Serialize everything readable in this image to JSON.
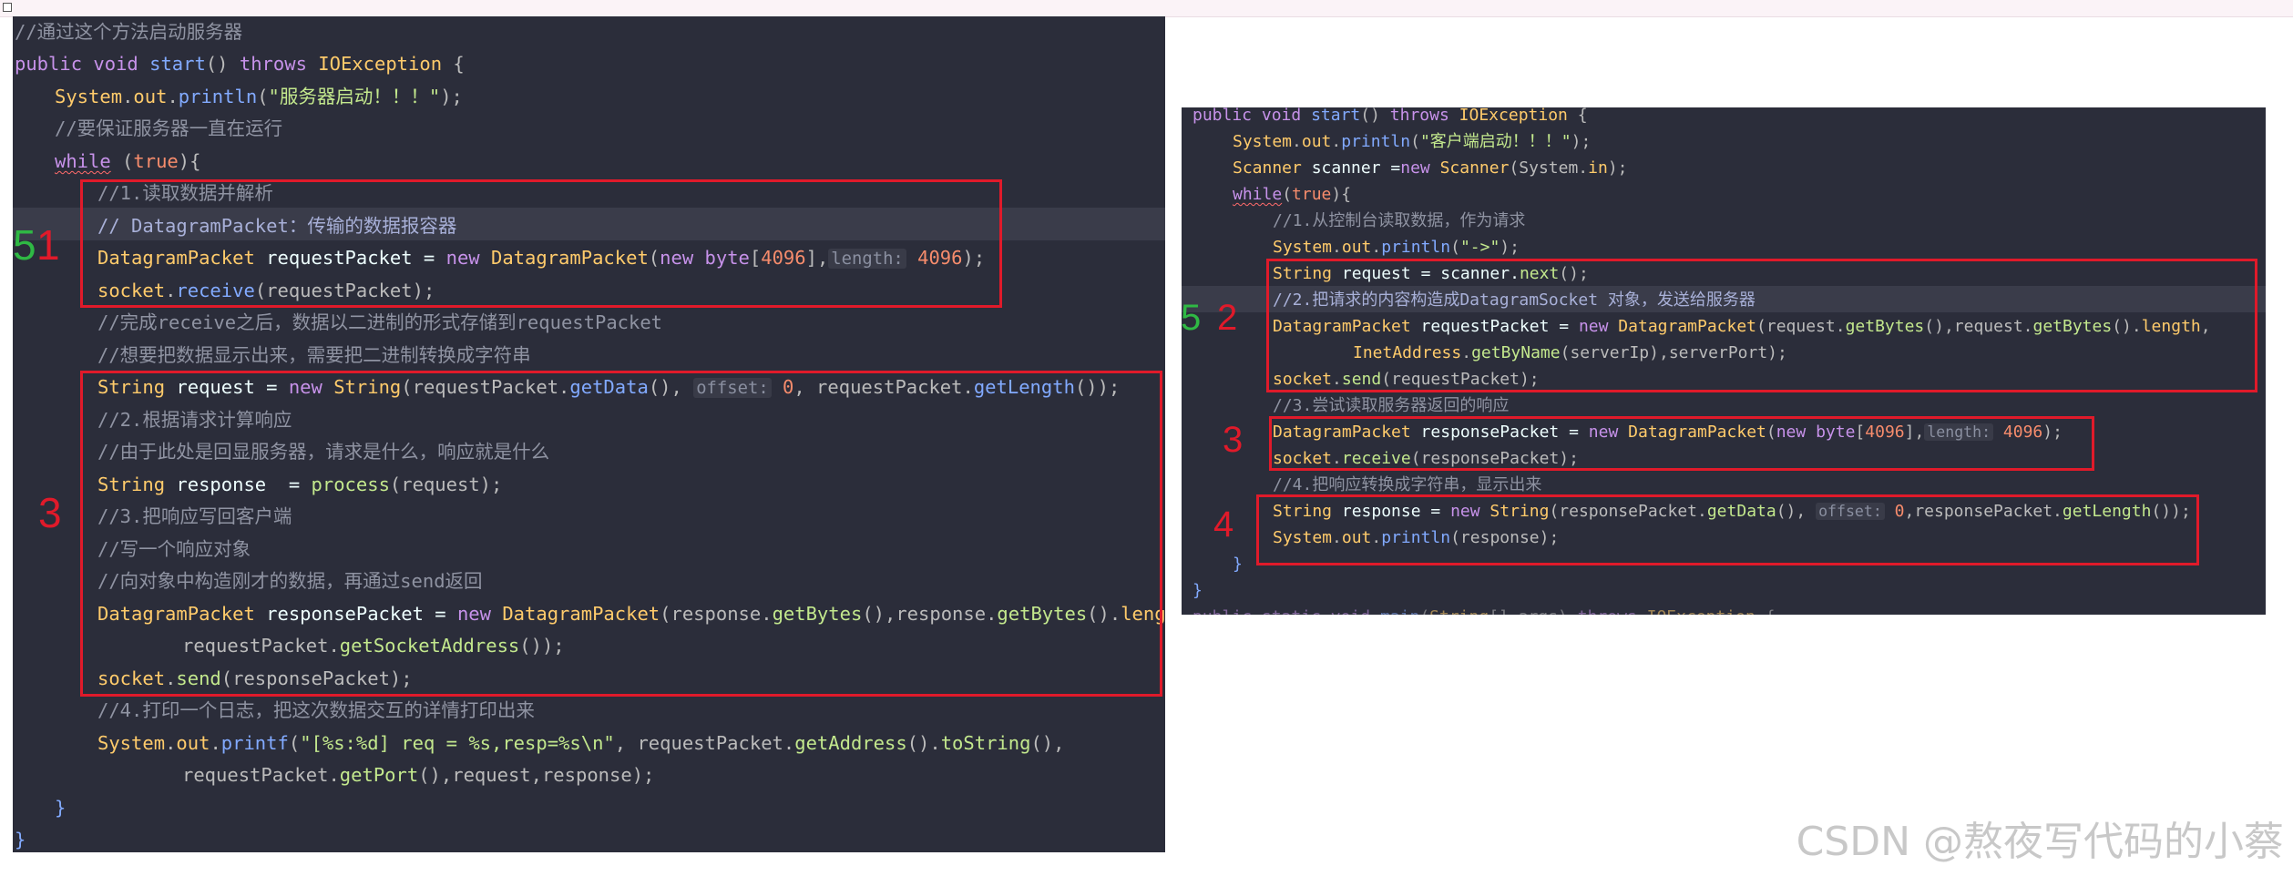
{
  "watermark": "CSDN @熬夜写代码的小蔡",
  "markers": {
    "left_green": "5",
    "left_red_1": "1",
    "left_red_3": "3",
    "right_green": "5",
    "right_red_2": "2",
    "right_red_3": "3",
    "right_red_4": "4"
  },
  "colors": {
    "background": "#2b2d3a",
    "comment": "#8f93a2",
    "keyword": "#c792ea",
    "type": "#ffcb6b",
    "method": "#c3e88d",
    "highlight_box": "#e01a2a",
    "marker_green": "#2fb844"
  },
  "left_code": {
    "l1": {
      "comment": "//通过这个方法启动服务器"
    },
    "l2": {
      "kw1": "public",
      "kw2": "void",
      "fn": "start",
      "p": "()",
      "kw3": "throws",
      "typ": "IOException",
      "brace": "{"
    },
    "l3": {
      "cls": "System",
      "dot1": ".",
      "fld": "out",
      "dot2": ".",
      "mtd": "println",
      "open": "(",
      "str": "\"服务器启动！！！\"",
      "close": ");"
    },
    "l4": {
      "comment": "//要保证服务器一直在运行"
    },
    "l5": {
      "kw": "while",
      "open": " (",
      "val": "true",
      "close": "){"
    },
    "l6": {
      "comment": "//1.读取数据并解析"
    },
    "l7": {
      "comment": "// DatagramPacket：传输的数据报容器"
    },
    "l8": {
      "typ": "DatagramPacket",
      "var": " requestPacket = ",
      "kw": "new",
      "typ2": "DatagramPacket",
      "open": "(",
      "kw2": "new",
      "typ3": "byte",
      "br1": "[",
      "num": "4096",
      "br2": "],",
      "hint": "length:",
      "num2": "4096",
      "close": ");"
    },
    "l9": {
      "obj": "socket",
      "dot": ".",
      "mtd": "receive",
      "args": "(requestPacket);"
    },
    "l10": {
      "comment": "//完成receive之后，数据以二进制的形式存储到requestPacket"
    },
    "l11": {
      "comment": "//想要把数据显示出来，需要把二进制转换成字符串"
    },
    "l12": {
      "typ": "String",
      "var": " request = ",
      "kw": "new",
      "typ2": "String",
      "open": "(requestPacket.",
      "mtd": "getData",
      "mid": "(),",
      "hint": "offset:",
      "num": "0",
      "mid2": ", requestPacket.",
      "mtd2": "getLength",
      "close": "());"
    },
    "l13": {
      "comment": "//2.根据请求计算响应"
    },
    "l14": {
      "comment": "//由于此处是回显服务器，请求是什么，响应就是什么"
    },
    "l15": {
      "typ": "String",
      "var": " response  = ",
      "mtd": "process",
      "args": "(request);"
    },
    "l16": {
      "comment": "//3.把响应写回客户端"
    },
    "l17": {
      "comment": "//写一个响应对象"
    },
    "l18": {
      "comment": "//向对象中构造刚才的数据，再通过send返回"
    },
    "l19": {
      "typ": "DatagramPacket",
      "var": " responsePacket = ",
      "kw": "new",
      "typ2": "DatagramPacket",
      "open": "(response.",
      "mtd": "getBytes",
      "mid": "(),response.",
      "mtd2": "getBytes",
      "mid2": "().",
      "fld": "length",
      "close": ","
    },
    "l20": {
      "pre": "requestPacket.",
      "mtd": "getSocketAddress",
      "close": "());"
    },
    "l21": {
      "obj": "socket",
      "dot": ".",
      "mtd": "send",
      "args": "(responsePacket);"
    },
    "l22": {
      "comment": "//4.打印一个日志，把这次数据交互的详情打印出来"
    },
    "l23": {
      "cls": "System",
      "dot1": ".",
      "fld": "out",
      "dot2": ".",
      "mtd": "printf",
      "open": "(",
      "str": "\"[%s:%d] req = %s,resp=%s\\n\"",
      "mid": ", requestPacket.",
      "mtd2": "getAddress",
      "mid2": "().",
      "mtd3": "toString",
      "close": "(),"
    },
    "l24": {
      "pre": "requestPacket.",
      "mtd": "getPort",
      "close": "(),request,response);"
    },
    "l25": {
      "brace": "}"
    },
    "l26": {
      "brace": "}"
    }
  },
  "right_code": {
    "r1": {
      "kw1": "public",
      "kw2": "void",
      "fn": "start",
      "p": "()",
      "kw3": "throws",
      "typ": "IOException",
      "brace": "{"
    },
    "r2": {
      "cls": "System",
      "dot1": ".",
      "fld": "out",
      "dot2": ".",
      "mtd": "println",
      "open": "(",
      "str": "\"客户端启动！！！\"",
      "close": ");"
    },
    "r3": {
      "typ": "Scanner",
      "var": " scanner =",
      "kw": "new",
      "typ2": " Scanner",
      "open": "(System.",
      "fld": "in",
      "close": ");"
    },
    "r4": {
      "kw": "while",
      "open": "(",
      "val": "true",
      "close": "){"
    },
    "r5": {
      "comment": "//1.从控制台读取数据，作为请求"
    },
    "r6": {
      "cls": "System",
      "dot1": ".",
      "fld": "out",
      "dot2": ".",
      "mtd": "println",
      "open": "(",
      "str": "\"->\"",
      "close": ");"
    },
    "r7": {
      "typ": "String",
      "var": " request = scanner.",
      "mtd": "next",
      "close": "();"
    },
    "r8": {
      "comment": "//2.把请求的内容构造成DatagramSocket 对象，发送给服务器"
    },
    "r9": {
      "typ": "DatagramPacket",
      "var": " requestPacket = ",
      "kw": "new",
      "typ2": " DatagramPacket",
      "open": "(request.",
      "mtd": "getBytes",
      "mid": "(),request.",
      "mtd2": "getBytes",
      "mid2": "().",
      "fld": "length",
      "close": ","
    },
    "r10": {
      "typ": "InetAddress",
      "dot": ".",
      "mtd": "getByName",
      "args": "(serverIp),serverPort);"
    },
    "r11": {
      "obj": "socket",
      "dot": ".",
      "mtd": "send",
      "args": "(requestPacket);"
    },
    "r12": {
      "comment": "//3.尝试读取服务器返回的响应"
    },
    "r13": {
      "typ": "DatagramPacket",
      "var": " responsePacket = ",
      "kw": "new",
      "typ2": " DatagramPacket",
      "open": "(",
      "kw2": "new",
      "typ3": " byte",
      "br1": "[",
      "num": "4096",
      "br2": "],",
      "hint": "length:",
      "num2": "4096",
      "close": ");"
    },
    "r14": {
      "obj": "socket",
      "dot": ".",
      "mtd": "receive",
      "args": "(responsePacket);"
    },
    "r15": {
      "comment": "//4.把响应转换成字符串，显示出来"
    },
    "r16": {
      "typ": "String",
      "var": " response = ",
      "kw": "new",
      "typ2": " String",
      "open": "(responsePacket.",
      "mtd": "getData",
      "mid": "(),",
      "hint": "offset:",
      "num": "0",
      "mid2": ",responsePacket.",
      "mtd2": "getLength",
      "close": "());"
    },
    "r17": {
      "cls": "System",
      "dot1": ".",
      "fld": "out",
      "dot2": ".",
      "mtd": "println",
      "args": "(response);"
    },
    "r18": {
      "brace": "}"
    },
    "r19": {
      "brace": "}"
    },
    "r20": {
      "kw1": "public",
      "kw2": "static",
      "kw3": "void",
      "fn": "main",
      "open": "(",
      "typ": "String",
      "args": "[] args) ",
      "kw4": "throws",
      "typ2": " IOException",
      "brace": " {"
    }
  }
}
